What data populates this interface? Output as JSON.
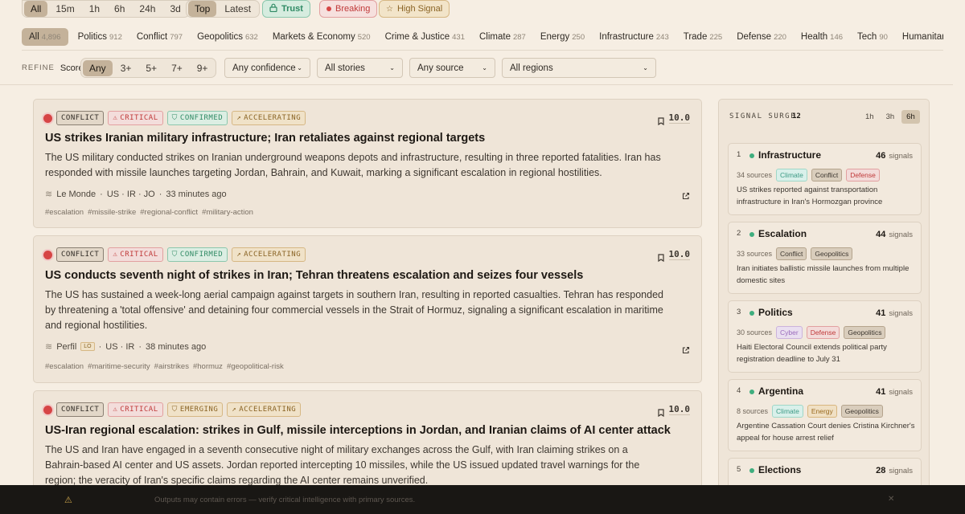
{
  "time_filters": {
    "items": [
      "All",
      "15m",
      "1h",
      "6h",
      "24h",
      "3d"
    ],
    "active": 0
  },
  "sort_filters": {
    "items": [
      "Top",
      "Latest"
    ],
    "active": 0
  },
  "mode_pills": {
    "trust": "Trust",
    "breaking": "Breaking",
    "high_signal": "High Signal"
  },
  "categories": [
    {
      "label": "All",
      "count": "4,896",
      "active": true
    },
    {
      "label": "Politics",
      "count": "912"
    },
    {
      "label": "Conflict",
      "count": "797"
    },
    {
      "label": "Geopolitics",
      "count": "632"
    },
    {
      "label": "Markets & Economy",
      "count": "520"
    },
    {
      "label": "Crime & Justice",
      "count": "431"
    },
    {
      "label": "Climate",
      "count": "287"
    },
    {
      "label": "Energy",
      "count": "250"
    },
    {
      "label": "Infrastructure",
      "count": "243"
    },
    {
      "label": "Trade",
      "count": "225"
    },
    {
      "label": "Defense",
      "count": "220"
    },
    {
      "label": "Health",
      "count": "146"
    },
    {
      "label": "Tech",
      "count": "90"
    },
    {
      "label": "Humanitar",
      "count": ""
    }
  ],
  "refine": {
    "label": "REFINE",
    "score_label": "Score",
    "score_options": [
      "Any",
      "3+",
      "5+",
      "7+",
      "9+"
    ],
    "active": 0,
    "selects": {
      "confidence": "Any confidence",
      "stories": "All stories",
      "source": "Any source",
      "regions": "All regions"
    }
  },
  "stories": [
    {
      "tags": [
        "CONFLICT",
        "CRITICAL",
        "CONFIRMED",
        "ACCELERATING"
      ],
      "score": "10.0",
      "title": "US strikes Iranian military infrastructure; Iran retaliates against regional targets",
      "desc": "The US military conducted strikes on Iranian underground weapons depots and infrastructure, resulting in three reported fatalities. Iran has responded with missile launches targeting Jordan, Bahrain, and Kuwait, marking a significant escalation in regional hostilities.",
      "source": "Le Monde",
      "regions": "US · IR · JO",
      "time": "33 minutes ago",
      "hashtags": [
        "#escalation",
        "#missile-strike",
        "#regional-conflict",
        "#military-action"
      ]
    },
    {
      "tags": [
        "CONFLICT",
        "CRITICAL",
        "CONFIRMED",
        "ACCELERATING"
      ],
      "score": "10.0",
      "title": "US conducts seventh night of strikes in Iran; Tehran threatens escalation and seizes four vessels",
      "desc": "The US has sustained a week-long aerial campaign against targets in southern Iran, resulting in reported casualties. Tehran has responded by threatening a 'total offensive' and detaining four commercial vessels in the Strait of Hormuz, signaling a significant escalation in maritime and regional hostilities.",
      "source": "Perfil",
      "badge": "LO",
      "regions": "US · IR",
      "time": "38 minutes ago",
      "hashtags": [
        "#escalation",
        "#maritime-security",
        "#airstrikes",
        "#hormuz",
        "#geopolitical-risk"
      ]
    },
    {
      "tags": [
        "CONFLICT",
        "CRITICAL",
        "EMERGING",
        "ACCELERATING"
      ],
      "score": "10.0",
      "title": "US-Iran regional escalation: strikes in Gulf, missile interceptions in Jordan, and Iranian claims of AI center attack",
      "desc": "The US and Iran have engaged in a seventh consecutive night of military exchanges across the Gulf, with Iran claiming strikes on a Bahrain-based AI center and US assets. Jordan reported intercepting 10 missiles, while the US issued updated travel warnings for the region; the veracity of Iran's specific claims regarding the AI center remains unverified."
    }
  ],
  "signal_surge": {
    "title": "SIGNAL SURGE",
    "count": "12",
    "windows": [
      "1h",
      "3h",
      "6h"
    ],
    "active": 2,
    "signals_label": "signals",
    "items": [
      {
        "rank": "1",
        "name": "Infrastructure",
        "signals": "46",
        "sources": "34 sources",
        "tags": [
          "Climate",
          "Conflict",
          "Defense"
        ],
        "desc": "US strikes reported against transportation infrastructure in Iran's Hormozgan province"
      },
      {
        "rank": "2",
        "name": "Escalation",
        "signals": "44",
        "sources": "33 sources",
        "tags": [
          "Conflict",
          "Geopolitics"
        ],
        "desc": "Iran initiates ballistic missile launches from multiple domestic sites"
      },
      {
        "rank": "3",
        "name": "Politics",
        "signals": "41",
        "sources": "30 sources",
        "tags": [
          "Cyber",
          "Defense",
          "Geopolitics"
        ],
        "desc": "Haiti Electoral Council extends political party registration deadline to July 31"
      },
      {
        "rank": "4",
        "name": "Argentina",
        "signals": "41",
        "sources": "8 sources",
        "tags": [
          "Climate",
          "Energy",
          "Geopolitics"
        ],
        "desc": "Argentine Cassation Court denies Cristina Kirchner's appeal for house arrest relief"
      },
      {
        "rank": "5",
        "name": "Elections",
        "signals": "28"
      }
    ]
  },
  "footer": {
    "text": "Outputs may contain errors — verify critical intelligence with primary sources."
  }
}
